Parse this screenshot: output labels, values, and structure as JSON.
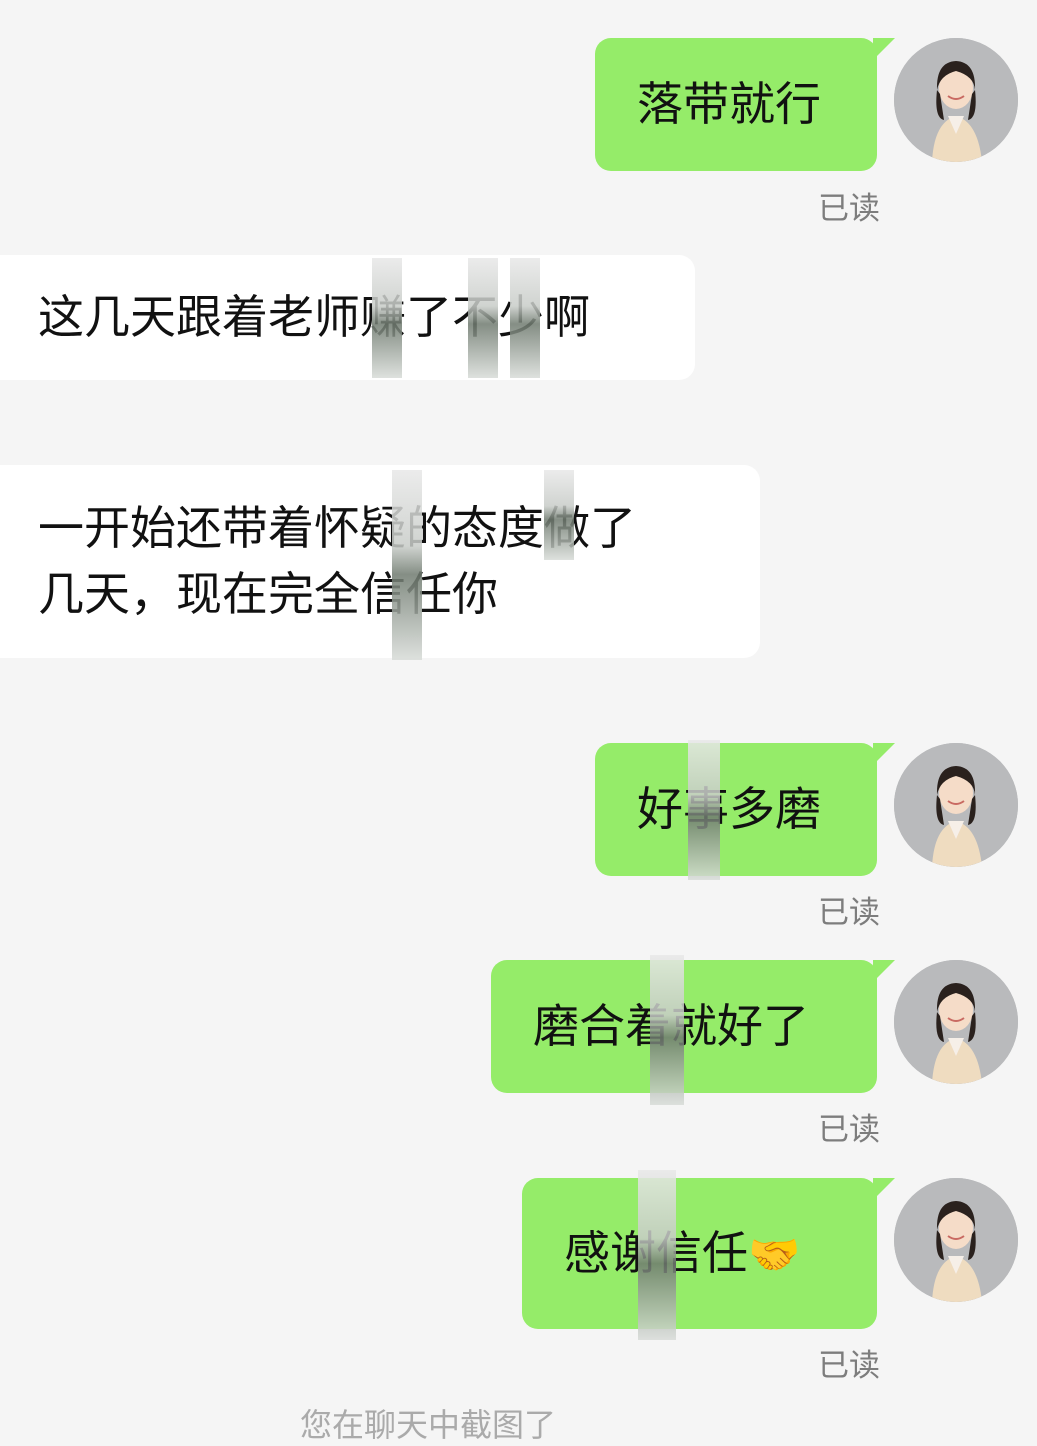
{
  "messages": [
    {
      "id": "m1",
      "side": "out",
      "text": "落带就行",
      "receipt": "已读"
    },
    {
      "id": "m2",
      "side": "in",
      "text": "这几天跟着老师赚了不少啊"
    },
    {
      "id": "m3",
      "side": "in",
      "line1": "一开始还带着怀疑的态度做了",
      "line2": "几天，现在完全信任你"
    },
    {
      "id": "m4",
      "side": "out",
      "text": "好事多磨",
      "receipt": "已读"
    },
    {
      "id": "m5",
      "side": "out",
      "text": "磨合着就好了",
      "receipt": "已读"
    },
    {
      "id": "m6",
      "side": "out",
      "text": "感谢信任",
      "emoji": "🤝",
      "receipt": "已读"
    }
  ],
  "bottom_hint": "您在聊天中截图了"
}
